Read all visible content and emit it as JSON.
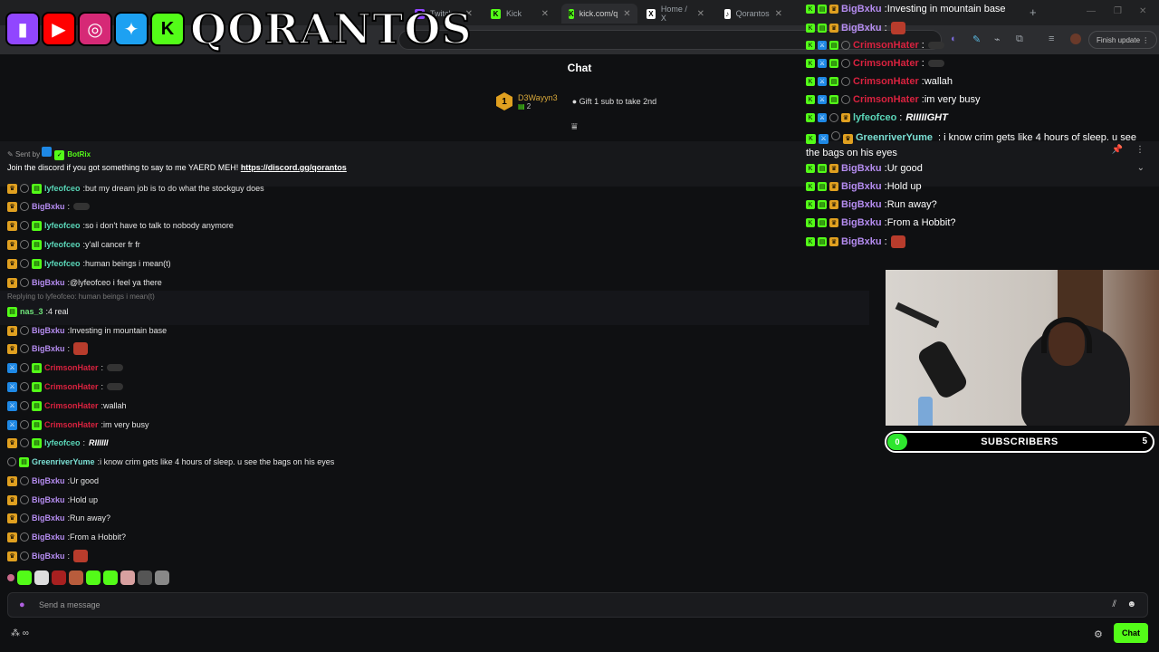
{
  "browser": {
    "tabs": [
      {
        "label": "Twitch",
        "fav": "T",
        "color": "#9146ff"
      },
      {
        "label": "Kick",
        "fav": "K",
        "color": "#53fc18"
      },
      {
        "label": "kick.com/q",
        "fav": "K",
        "color": "#53fc18"
      },
      {
        "label": "Home / X",
        "fav": "X",
        "color": "#ffffff"
      },
      {
        "label": "Qorantos",
        "fav": "♪",
        "color": "#ffffff"
      }
    ],
    "finish_update": "Finish update"
  },
  "logo": {
    "text": "QORANTOS",
    "icons": [
      "twitch-icon",
      "youtube-icon",
      "instagram-icon",
      "twitter-icon",
      "kick-icon"
    ]
  },
  "chat": {
    "title": "Chat",
    "gifter": {
      "rank": "1",
      "name": "D3Wayyn3",
      "count": "2",
      "gift_text": "Gift 1 sub to take 2nd"
    },
    "pinned": {
      "sent_by_prefix": "Sent by",
      "sender": "BotRix",
      "message": "Join the discord if you got something to say to me YAERD MEH!",
      "link": "https://discord.gg/qorantos"
    },
    "messages": [
      {
        "user": "lyfeofceo",
        "color": "green",
        "text": "but my dream job is to do what the stockguy does",
        "badges": [
          "crown",
          "ring",
          "gift"
        ]
      },
      {
        "user": "BigBxku",
        "color": "purple",
        "text": "",
        "emote": "dark",
        "badges": [
          "crown",
          "ring"
        ]
      },
      {
        "user": "lyfeofceo",
        "color": "green",
        "text": "so i don't have to talk to nobody anymore",
        "badges": [
          "crown",
          "ring",
          "gift"
        ]
      },
      {
        "user": "lyfeofceo",
        "color": "green",
        "text": "y'all cancer fr fr",
        "badges": [
          "crown",
          "ring",
          "gift"
        ]
      },
      {
        "user": "lyfeofceo",
        "color": "green",
        "text": "human beings i mean(t)",
        "badges": [
          "crown",
          "ring",
          "gift"
        ]
      },
      {
        "user": "BigBxku",
        "color": "purple",
        "text": "@lyfeofceo i feel ya there",
        "badges": [
          "crown",
          "ring"
        ]
      },
      {
        "reply": "Replying to lyfeofceo: human beings i mean(t)"
      },
      {
        "user": "nas_3",
        "color": "lime",
        "text": "4 real",
        "badges": [
          "gift"
        ]
      },
      {
        "user": "BigBxku",
        "color": "purple",
        "text": "Investing in mountain base",
        "badges": [
          "crown",
          "ring"
        ]
      },
      {
        "user": "BigBxku",
        "color": "purple",
        "text": "",
        "emote": "red",
        "badges": [
          "crown",
          "ring"
        ]
      },
      {
        "user": "CrimsonHater",
        "color": "red",
        "text": "",
        "emote": "dark",
        "badges": [
          "mod",
          "ring",
          "gift"
        ]
      },
      {
        "user": "CrimsonHater",
        "color": "red",
        "text": "",
        "emote": "dark",
        "badges": [
          "mod",
          "ring",
          "gift"
        ]
      },
      {
        "user": "CrimsonHater",
        "color": "red",
        "text": "wallah",
        "badges": [
          "mod",
          "ring",
          "gift"
        ]
      },
      {
        "user": "CrimsonHater",
        "color": "red",
        "text": "im very busy",
        "badges": [
          "mod",
          "ring",
          "gift"
        ]
      },
      {
        "user": "lyfeofceo",
        "color": "green",
        "text": "",
        "emote": "text",
        "emote_text": "RIIIIII",
        "badges": [
          "crown",
          "ring",
          "gift"
        ]
      },
      {
        "user": "GreenriverYume",
        "color": "teal",
        "text": "i know crim gets like 4 hours of sleep. u see the bags on his eyes",
        "badges": [
          "ring",
          "gift"
        ]
      },
      {
        "user": "BigBxku",
        "color": "purple",
        "text": "Ur good",
        "badges": [
          "crown",
          "ring"
        ]
      },
      {
        "user": "BigBxku",
        "color": "purple",
        "text": "Hold up",
        "badges": [
          "crown",
          "ring"
        ]
      },
      {
        "user": "BigBxku",
        "color": "purple",
        "text": "Run away?",
        "badges": [
          "crown",
          "ring"
        ]
      },
      {
        "user": "BigBxku",
        "color": "purple",
        "text": "From a Hobbit?",
        "badges": [
          "crown",
          "ring"
        ]
      },
      {
        "user": "BigBxku",
        "color": "purple",
        "text": "",
        "emote": "red",
        "badges": [
          "crown",
          "ring"
        ]
      }
    ],
    "input_placeholder": "Send a message",
    "send_label": "Chat"
  },
  "overlay_chat": [
    {
      "user": "BigBxku",
      "color": "purple",
      "text": "Investing in mountain base"
    },
    {
      "user": "BigBxku",
      "color": "purple",
      "text": "",
      "emote": "red"
    },
    {
      "user": "CrimsonHater",
      "color": "red",
      "text": "",
      "emote": "dark"
    },
    {
      "user": "CrimsonHater",
      "color": "red",
      "text": "",
      "emote": "dark"
    },
    {
      "user": "CrimsonHater",
      "color": "red",
      "text": "wallah"
    },
    {
      "user": "CrimsonHater",
      "color": "red",
      "text": "im very busy"
    },
    {
      "user": "lyfeofceo",
      "color": "green",
      "text": "",
      "emote": "text",
      "emote_text": "RIIIIIGHT"
    },
    {
      "user": "GreenriverYume",
      "color": "teal",
      "text": "i know crim gets like 4 hours of sleep. u see the bags on his eyes",
      "wrap": true
    },
    {
      "user": "BigBxku",
      "color": "purple",
      "text": "Ur good"
    },
    {
      "user": "BigBxku",
      "color": "purple",
      "text": "Hold up"
    },
    {
      "user": "BigBxku",
      "color": "purple",
      "text": "Run away?"
    },
    {
      "user": "BigBxku",
      "color": "purple",
      "text": "From a Hobbit?"
    },
    {
      "user": "BigBxku",
      "color": "purple",
      "text": "",
      "emote": "red"
    }
  ],
  "subs_goal": {
    "label": "SUBSCRIBERS",
    "current": "0",
    "target": "5",
    "progress": 0.0
  },
  "colors": {
    "kick_green": "#53fc18",
    "background": "#0f1012"
  }
}
